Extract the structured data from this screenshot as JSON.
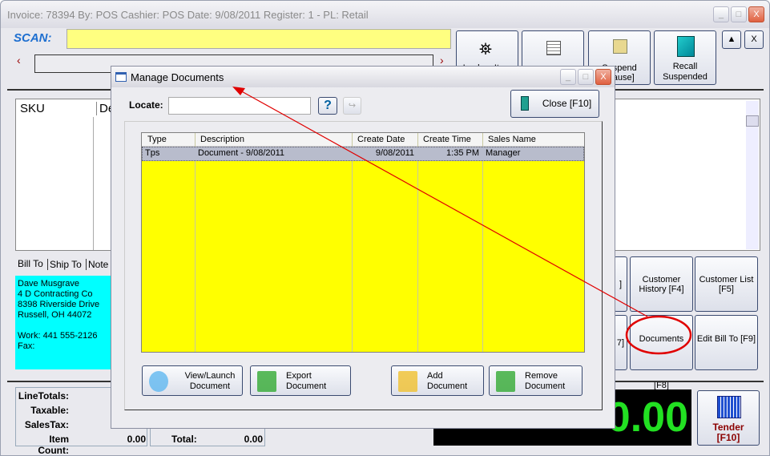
{
  "window": {
    "title": "Invoice: 78394  By: POS  Cashier: POS  Date:  9/08/2011  Register: 1 - PL: Retail",
    "min": "_",
    "max": "□",
    "close": "X"
  },
  "scan": {
    "label": "SCAN:",
    "value": "",
    "prev": "‹",
    "next": "›"
  },
  "toolbar": [
    {
      "label": "Lookup Item",
      "icon": "binoculars-icon"
    },
    {
      "label": "",
      "icon": "spreadsheet-icon"
    },
    {
      "label": "Suspend [Pause]",
      "icon": "suspend-icon"
    },
    {
      "label": "Recall Suspended",
      "icon": "recall-icon"
    }
  ],
  "small_buttons": {
    "up": "▲",
    "close": "X"
  },
  "items_grid": {
    "columns": [
      "SKU",
      "De"
    ]
  },
  "customer": {
    "tabs": [
      "Bill To",
      "Ship To",
      "Note"
    ],
    "lines": [
      "Dave Musgrave",
      "4 D Contracting Co",
      "8398 Riverside Drive",
      "Russell, OH  44072",
      "",
      "Work: 441 555-2126",
      "Fax:"
    ]
  },
  "action_buttons": [
    "]",
    "Customer History [F4]",
    "Customer List [F5]",
    "7]",
    "Documents [F8]",
    "Edit Bill To [F9]"
  ],
  "totals": {
    "labels": [
      "LineTotals:",
      "Taxable:",
      "SalesTax:",
      "Item Count:"
    ],
    "item_count": "0.00",
    "total_label": "Total:",
    "total": "0.00",
    "display": "0.00"
  },
  "tender": {
    "label": "Tender",
    "key": "[F10]"
  },
  "dialog": {
    "title": "Manage Documents",
    "locate_label": "Locate:",
    "locate_value": "",
    "help": "?",
    "close": "Close [F10]",
    "columns": [
      "Type",
      "Description",
      "Create Date",
      "Create Time",
      "Sales Name"
    ],
    "rows": [
      [
        "Tps",
        "Document -  9/08/2011",
        "9/08/2011",
        "1:35 PM",
        "Manager"
      ]
    ],
    "buttons": [
      {
        "l1": "View/Launch",
        "l2": "Document"
      },
      {
        "l1": "Export",
        "l2": "Document"
      },
      {
        "l1": "Add",
        "l2": "Document"
      },
      {
        "l1": "Remove",
        "l2": "Document"
      }
    ]
  },
  "colors": {
    "annotation": "#e00000",
    "scan_field": "#ffff80",
    "grid": "#ffff00",
    "customer": "#00ffff",
    "display_text": "#22e022"
  }
}
